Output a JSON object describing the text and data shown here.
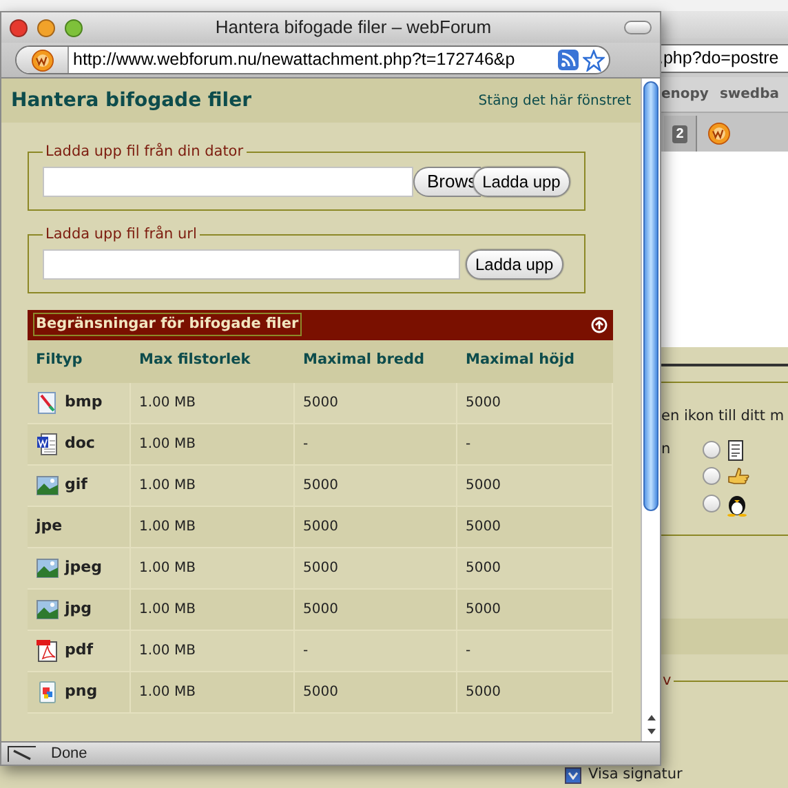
{
  "popup": {
    "title": "Hantera bifogade filer – webForum",
    "url": "http://www.webforum.nu/newattachment.php?t=172746&p",
    "heading": "Hantera bifogade filer",
    "close_link": "Stäng det här fönstret",
    "upload_sections": [
      {
        "legend": "Ladda upp fil från din dator",
        "buttons": [
          {
            "label": "Brows",
            "kind": "browse"
          },
          {
            "label": "Ladda upp",
            "kind": "upload"
          }
        ]
      },
      {
        "legend": "Ladda upp fil från url",
        "buttons": [
          {
            "label": "Ladda upp",
            "kind": "upload"
          }
        ]
      }
    ],
    "limits": {
      "title": "Begränsningar för bifogade filer",
      "columns": [
        "Filtyp",
        "Max filstorlek",
        "Maximal bredd",
        "Maximal höjd"
      ],
      "rows": [
        {
          "kind": "paint",
          "cells": [
            "bmp",
            "1.00 MB",
            "5000",
            "5000"
          ]
        },
        {
          "kind": "word",
          "cells": [
            "doc",
            "1.00 MB",
            "-",
            "-"
          ]
        },
        {
          "kind": "image",
          "cells": [
            "gif",
            "1.00 MB",
            "5000",
            "5000"
          ]
        },
        {
          "kind": "none",
          "cells": [
            "jpe",
            "1.00 MB",
            "5000",
            "5000"
          ]
        },
        {
          "kind": "image",
          "cells": [
            "jpeg",
            "1.00 MB",
            "5000",
            "5000"
          ]
        },
        {
          "kind": "image",
          "cells": [
            "jpg",
            "1.00 MB",
            "5000",
            "5000"
          ]
        },
        {
          "kind": "pdf",
          "cells": [
            "pdf",
            "1.00 MB",
            "-",
            "-"
          ]
        },
        {
          "kind": "png",
          "cells": [
            "png",
            "1.00 MB",
            "5000",
            "5000"
          ]
        }
      ]
    },
    "status_bar": "Done"
  },
  "background_window": {
    "url": ".php?do=postre",
    "bookmarks": [
      "enopy",
      "swedba"
    ],
    "tab_badge": "2",
    "icon_prompt": "en ikon till ditt m",
    "icon_label": "n",
    "icon_options": [
      {
        "kind": "document",
        "selected": false
      },
      {
        "kind": "thumb",
        "selected": false
      },
      {
        "kind": "penguin",
        "selected": false
      }
    ],
    "legend": "v",
    "checkboxes": [
      {
        "label": "Visa signatur",
        "checked": true
      }
    ]
  }
}
